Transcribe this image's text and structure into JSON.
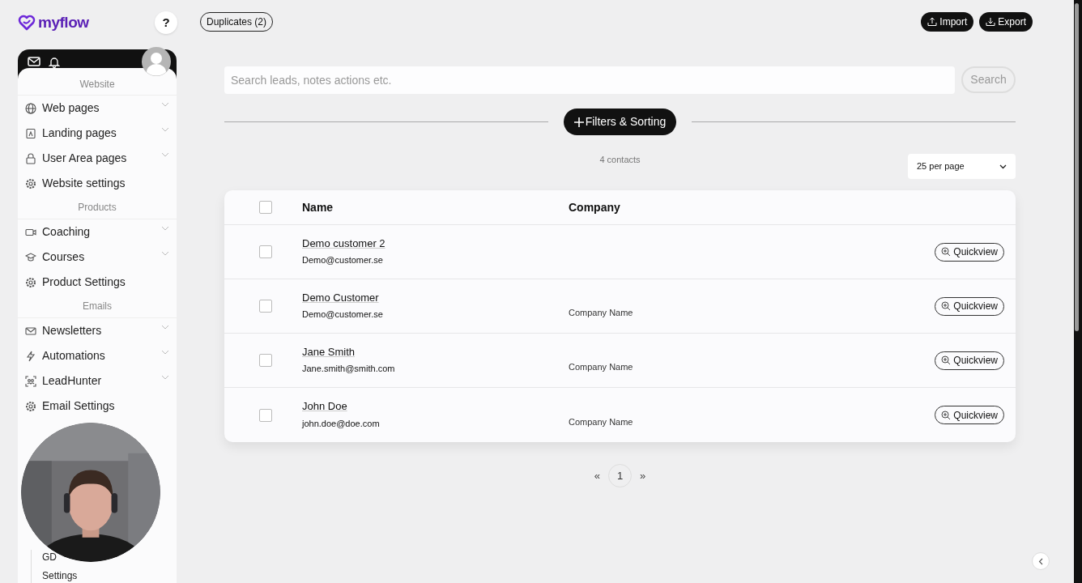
{
  "logo": {
    "text": "myflow"
  },
  "help_button": "?",
  "sidebar": {
    "sections": [
      {
        "title": "Website",
        "items": [
          {
            "label": "Web pages",
            "expandable": true
          },
          {
            "label": "Landing pages",
            "expandable": true
          },
          {
            "label": "User Area pages",
            "expandable": true
          },
          {
            "label": "Website settings",
            "expandable": false
          }
        ]
      },
      {
        "title": "Products",
        "items": [
          {
            "label": "Coaching",
            "expandable": true
          },
          {
            "label": "Courses",
            "expandable": true
          },
          {
            "label": "Product Settings",
            "expandable": false
          }
        ]
      },
      {
        "title": "Emails",
        "items": [
          {
            "label": "Newsletters",
            "expandable": true
          },
          {
            "label": "Automations",
            "expandable": true
          },
          {
            "label": "LeadHunter",
            "expandable": true
          },
          {
            "label": "Email Settings",
            "expandable": false
          }
        ]
      }
    ],
    "sub_items": [
      "GD",
      "Settings"
    ]
  },
  "top_buttons": {
    "duplicates": "Duplicates (2)",
    "import": "Import",
    "export": "Export"
  },
  "search": {
    "placeholder": "Search leads, notes actions etc.",
    "button": "Search"
  },
  "filters_button": "Filters & Sorting",
  "count": "4 contacts",
  "per_page": "25 per page",
  "table": {
    "columns": [
      "Name",
      "Company"
    ],
    "all_checked": false,
    "rows": [
      {
        "name": "Demo customer 2",
        "email": "Demo@customer.se",
        "checked": false,
        "action": "Quickview"
      },
      {
        "name": "Demo Customer",
        "email": "Demo@customer.se",
        "company": "Company Name",
        "checked": false,
        "action": "Quickview"
      },
      {
        "name": "Jane Smith",
        "email": "Jane.smith@smith.com",
        "company": "Company Name",
        "checked": false,
        "action": "Quickview"
      },
      {
        "name": "John Doe",
        "email": "john.doe@doe.com",
        "company": "Company Name",
        "checked": false,
        "action": "Quickview"
      }
    ]
  },
  "pagination": {
    "prev": "«",
    "pages": [
      {
        "label": "1",
        "selected": true
      }
    ],
    "next": "»"
  }
}
